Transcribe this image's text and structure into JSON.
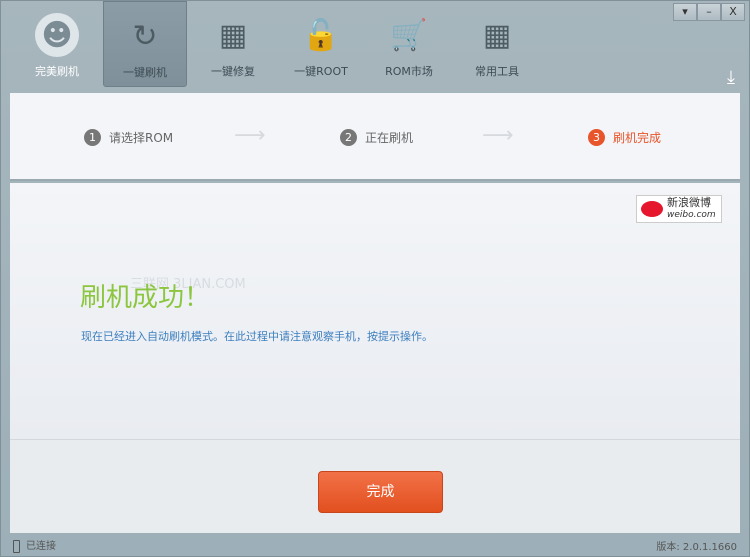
{
  "nav": [
    {
      "label": "完美刷机",
      "icon": "android-icon"
    },
    {
      "label": "一键刷机",
      "icon": "tap-refresh-icon"
    },
    {
      "label": "一键修复",
      "icon": "repair-icon"
    },
    {
      "label": "一键ROOT",
      "icon": "unlock-icon"
    },
    {
      "label": "ROM市场",
      "icon": "cart-icon"
    },
    {
      "label": "常用工具",
      "icon": "tools-icon"
    }
  ],
  "window_controls": {
    "menu": "▾",
    "minimize": "–",
    "close": "X"
  },
  "steps": [
    {
      "num": "1",
      "label": "请选择ROM"
    },
    {
      "num": "2",
      "label": "正在刷机"
    },
    {
      "num": "3",
      "label": "刷机完成"
    }
  ],
  "weibo": {
    "label": "新浪微博",
    "sub": "weibo.com"
  },
  "watermark": "三联网 3LIAN.COM",
  "main": {
    "title": "刷机成功！",
    "desc": "现在已经进入自动刷机模式。在此过程中请注意观察手机，按提示操作。"
  },
  "done_button": "完成",
  "status": {
    "connection": "已连接",
    "version": "版本: 2.0.1.1660"
  },
  "colors": {
    "accent": "#e8552b",
    "success": "#8cc63f",
    "link": "#3d7fbf"
  }
}
